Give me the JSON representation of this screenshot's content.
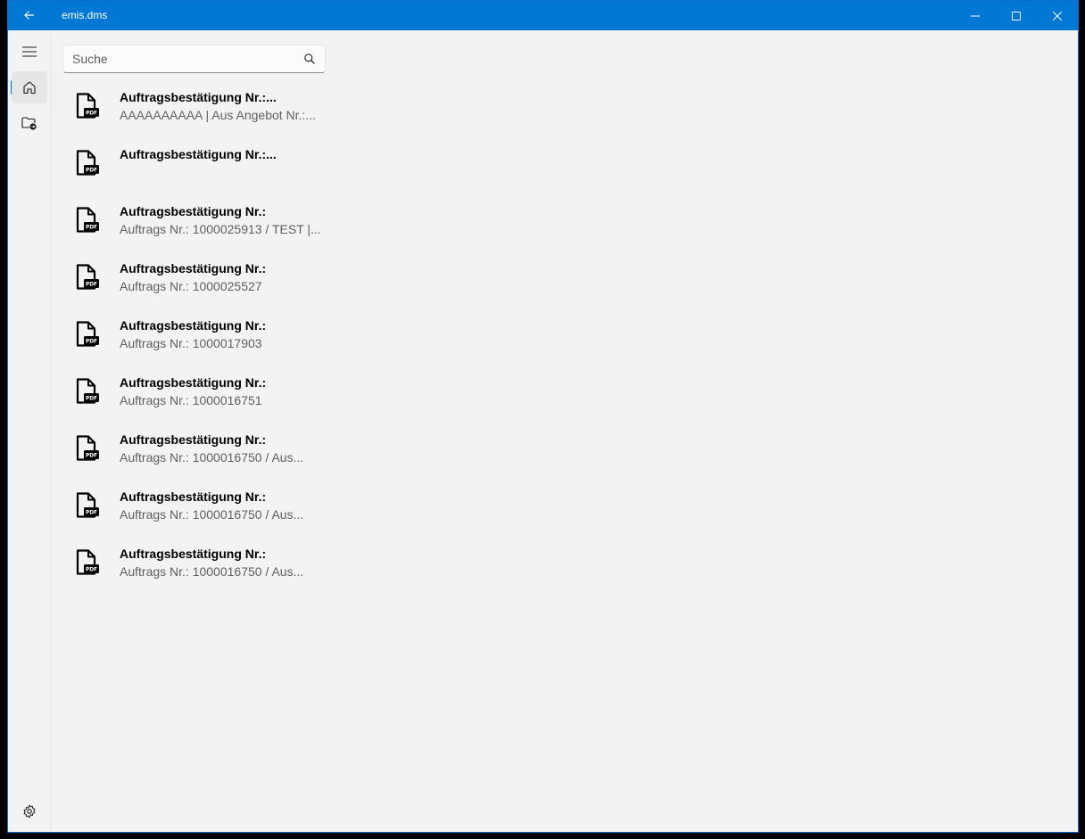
{
  "window": {
    "title": "emis.dms"
  },
  "search": {
    "placeholder": "Suche",
    "value": ""
  },
  "documents": [
    {
      "title": "Auftragsbestätigung Nr.:...",
      "subtitle": "AAAAAAAAAA | Aus Angebot Nr.:...",
      "icon": "pdf-file-icon"
    },
    {
      "title": "Auftragsbestätigung Nr.:...",
      "subtitle": "",
      "icon": "pdf-file-icon"
    },
    {
      "title": "Auftragsbestätigung Nr.:",
      "subtitle": "Auftrags Nr.: 1000025913 / TEST |...",
      "icon": "pdf-file-icon"
    },
    {
      "title": "Auftragsbestätigung Nr.:",
      "subtitle": "Auftrags Nr.: 1000025527",
      "icon": "pdf-file-icon"
    },
    {
      "title": "Auftragsbestätigung Nr.:",
      "subtitle": "Auftrags Nr.: 1000017903",
      "icon": "pdf-file-icon"
    },
    {
      "title": "Auftragsbestätigung Nr.:",
      "subtitle": "Auftrags Nr.: 1000016751",
      "icon": "pdf-file-icon"
    },
    {
      "title": "Auftragsbestätigung Nr.:",
      "subtitle": "Auftrags Nr.: 1000016750 / Aus...",
      "icon": "pdf-file-icon"
    },
    {
      "title": "Auftragsbestätigung Nr.:",
      "subtitle": "Auftrags Nr.: 1000016750 / Aus...",
      "icon": "pdf-file-icon"
    },
    {
      "title": "Auftragsbestätigung Nr.:",
      "subtitle": "Auftrags Nr.: 1000016750 / Aus...",
      "icon": "pdf-file-icon"
    }
  ],
  "nav": {
    "items": [
      {
        "icon": "hamburger-menu-icon"
      },
      {
        "icon": "home-icon",
        "selected": true
      },
      {
        "icon": "folder-export-icon"
      }
    ],
    "footer": {
      "icon": "gear-icon"
    }
  },
  "colors": {
    "accent": "#0078d4",
    "background": "#f3f3f3",
    "selection_indicator": "#0067c0"
  }
}
